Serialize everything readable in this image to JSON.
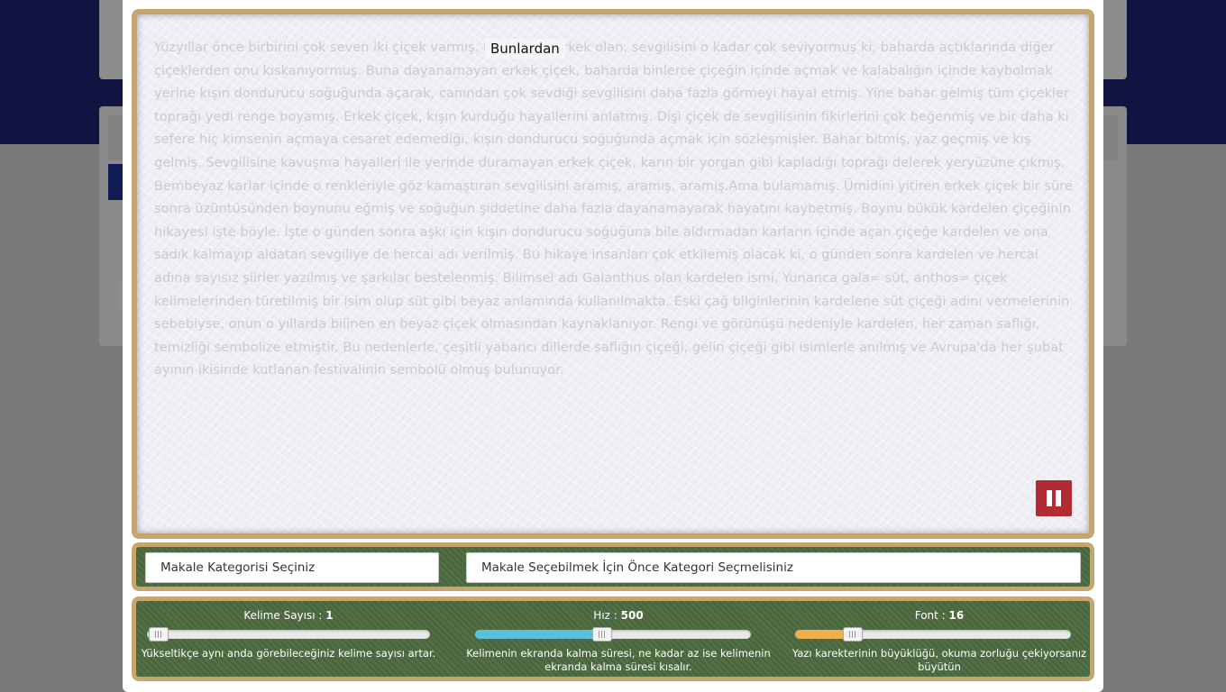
{
  "modal": {
    "current_word": "Bunlardan",
    "article_text": "Yüzyıllar önce birbirini çok seven iki çiçek varmış. Bunlardan erkek olan, sevgilisini o kadar çok seviyormuş ki, baharda açtıklarında diğer çiçeklerden onu kıskanıyormuş. Buna dayanamayan erkek çiçek, baharda binlerce çiçeğin içinde açmak ve kalabalığın içinde kaybolmak yerine kışın dondurucu soğuğunda açarak, canından çok sevdiği sevgilisini daha fazla görmeyi hayal etmiş. Yine bahar gelmiş tüm çiçekler toprağı yedi renge boyamış. Erkek çiçek, kışın kurduğu hayallerini anlatmış. Dişi çiçek de sevgilisinin fikirlerini çok beğenmiş ve bir daha ki sefere hiç kimsenin açmaya cesaret edemediği, kışın dondurucu soğuğunda açmak için sözleşmişler. Bahar bitmiş, yaz geçmiş ve kış gelmiş. Sevgilisine kavuşma hayalleri ile yerinde duramayan erkek çiçek, karın bir yorgan gibi kapladığı toprağı delerek yeryüzüne çıkmış. Bembeyaz karlar içinde o renkleriyle göz kamaştıran sevgilisini aramış, aramış, aramış.Ama bulamamış. Ümidini yitiren erkek çiçek bir süre sonra üzüntüsünden boynunu eğmiş ve soğuğun şiddetine daha fazla dayanamayarak hayatını kaybetmiş. Boynu bükük kardelen çiçeğinin hikayesi işte böyle. İşte o günden sonra aşkı için kışın dondurucu soğuğuna bile aldırmadan karların içinde açan çiçeğe kardelen ve ona sadık kalmayıp aldatan sevgiliye de hercai adı verilmiş. Bu hikaye insanları çok etkilemiş olacak ki, o günden sonra kardelen ve hercai adına sayısız şiirler yazılmış ve şarkılar bestelenmiş. Bilimsel adı Galanthus olan kardelen ismi, Yunanca gala= süt, anthos= çiçek kelimelerinden türetilmiş bir isim olup süt gibi beyaz anlamında kullanılmakta. Eski çağ bilginlerinin kardelene süt çiçeği adını vermelerinin sebebiyse, onun o yıllarda bilinen en beyaz çiçek olmasından kaynaklanıyor. Rengi ve görünüşü nedeniyle kardelen, her zaman saflığı, temizliği sembolize etmiştir. Bu nedenlerle, çeşitli yabancı dillerde saflığın çiçeği, gelin çiçeği gibi isimlerle anılmış ve Avrupa'da her şubat ayının ikisinde kutlanan festivalinin sembolü olmuş bulunuyor.",
    "pause_icon": "pause-icon",
    "colors": {
      "frame": "#c4a66e",
      "pause": "#b02b34",
      "panel": "#4c6a3f",
      "speed_fill": "#5bc0de",
      "font_fill": "#f0ad4e"
    }
  },
  "selects": {
    "category": "Makale Kategorisi Seçiniz",
    "article": "Makale Seçebilmek İçin Önce Kategori Seçmelisiniz"
  },
  "controls": {
    "word_count": {
      "label": "Kelime Sayısı : ",
      "value": "1",
      "level": 0.04,
      "description": "Yükseltikçe aynı anda görebileceğiniz kelime sayısı artar."
    },
    "speed": {
      "label": "Hız : ",
      "value": "500",
      "level": 0.46,
      "description": "Kelimenin ekranda kalma süresi, ne kadar az ise kelimenin ekranda kalma süresi kısalır."
    },
    "font": {
      "label": "Font : ",
      "value": "16",
      "level": 0.21,
      "description": "Yazı karekterinin büyüklüğü, okuma zorluğu çekiyorsanız büyütün"
    }
  }
}
